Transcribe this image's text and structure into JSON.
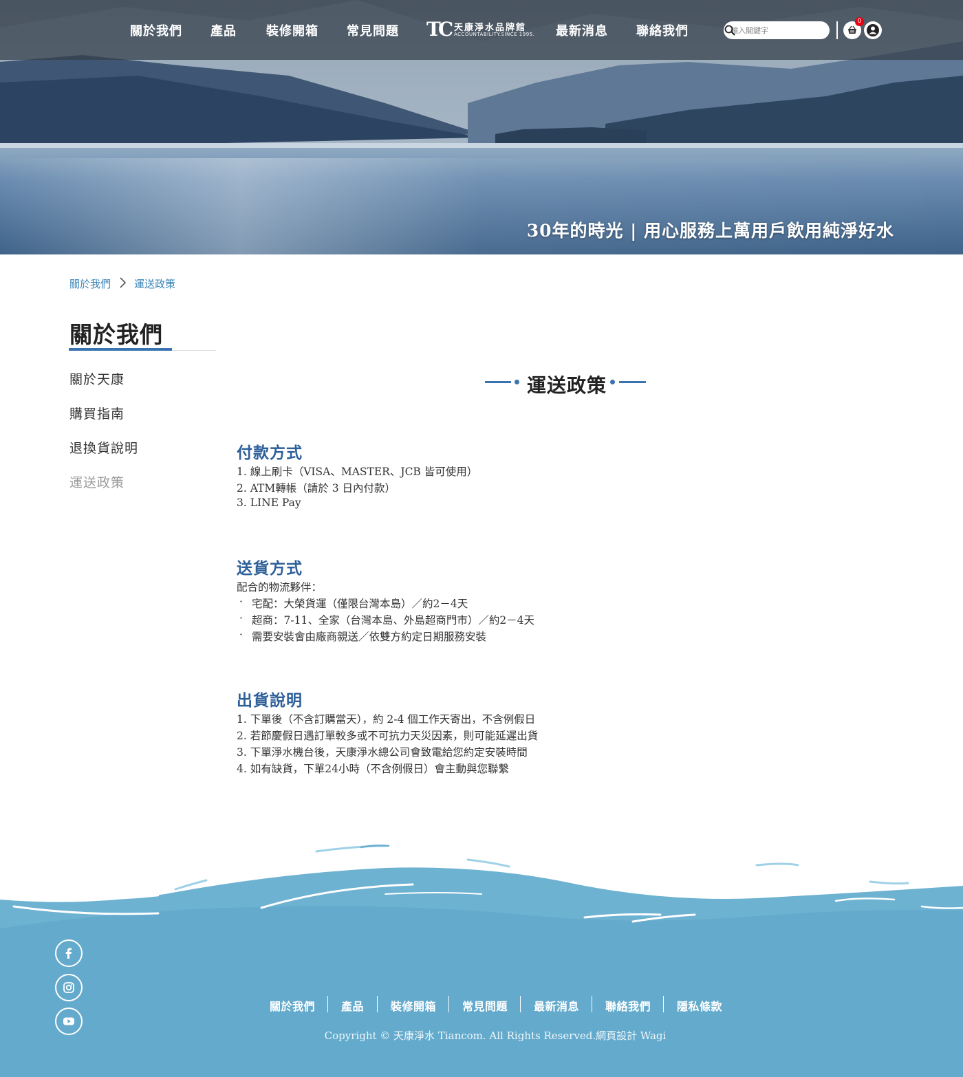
{
  "header": {
    "nav_left": [
      "關於我們",
      "產品",
      "裝修開箱",
      "常見問題"
    ],
    "nav_right": [
      "最新消息",
      "聯絡我們"
    ],
    "logo": {
      "mark": "TC",
      "name": "天康淨水品牌館",
      "tagline": "ACCOUNTABILITY.SINCE 1995."
    },
    "search": {
      "placeholder": "輸入關鍵字"
    },
    "cart_count": "0"
  },
  "hero": {
    "slogan": "30年的時光 | 用心服務上萬用戶飲用純淨好水"
  },
  "breadcrumb": {
    "items": [
      "關於我們",
      "運送政策"
    ]
  },
  "sidebar": {
    "title": "關於我們",
    "items": [
      {
        "label": "關於天康"
      },
      {
        "label": "購買指南"
      },
      {
        "label": "退換貨說明"
      },
      {
        "label": "運送政策"
      }
    ],
    "active": "運送政策"
  },
  "content": {
    "title": "運送政策",
    "payment": {
      "heading": "付款方式",
      "lines": [
        "1. 線上刷卡（VISA、MASTER、JCB 皆可使用）",
        "2. ATM轉帳（請於 3 日內付款）",
        "3. LINE Pay"
      ]
    },
    "delivery": {
      "heading": "送貨方式",
      "intro": "配合的物流夥伴：",
      "bullets": [
        "宅配：大榮貨運（僅限台灣本島）／約2－4天",
        "超商：7-11、全家（台灣本島、外島超商門市）／約2－4天",
        "需要安裝會由廠商親送／依雙方約定日期服務安裝"
      ]
    },
    "shipping": {
      "heading": "出貨說明",
      "lines": [
        "1. 下單後（不含訂購當天），約 2-4 個工作天寄出，不含例假日",
        "2. 若節慶假日遇訂單較多或不可抗力天災因素，則可能延遲出貨",
        "3. 下單淨水機台後，天康淨水總公司會致電給您約定安裝時間",
        "4. 如有缺貨，下單24小時（不含例假日）會主動與您聯繫"
      ]
    }
  },
  "footer": {
    "links": [
      "關於我們",
      "產品",
      "裝修開箱",
      "常見問題",
      "最新消息",
      "聯絡我們",
      "隱私條款"
    ],
    "copyright": "Copyright © 天康淨水 Tiancom. All Rights Reserved.網頁設計 Wagi",
    "social": [
      "facebook-icon",
      "instagram-icon",
      "youtube-icon"
    ]
  },
  "colors": {
    "accent": "#3a73b0",
    "heading_blue": "#2d5f99",
    "link_blue": "#3a86b8",
    "footer_water": "#68b0d0"
  }
}
